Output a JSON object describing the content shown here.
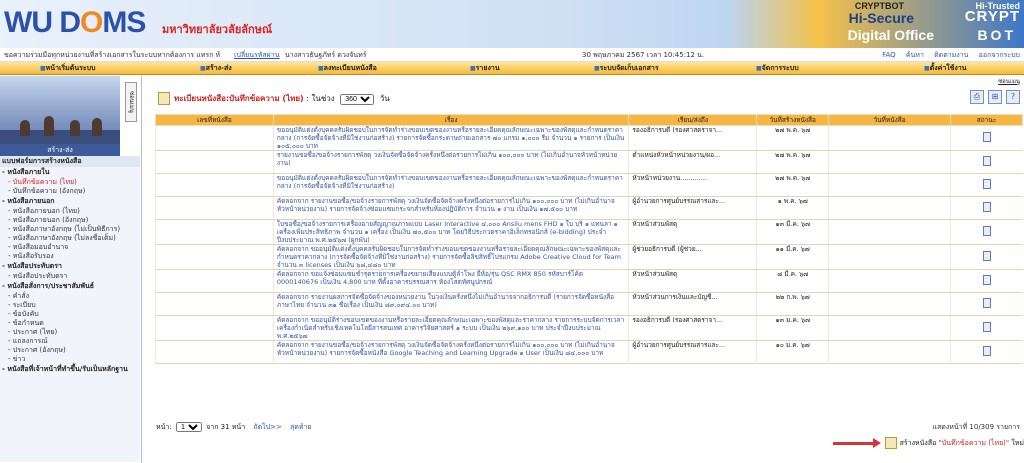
{
  "header": {
    "logo_a": "WU D",
    "logo_b": "O",
    "logo_c": "MS",
    "university": "มหาวิทยาลัยวลัยลักษณ์",
    "brand_line1": "CRYPTBOT",
    "brand_line2": "Hi-Secure",
    "brand_line3": "Digital Office",
    "brand_right1": "Hi-Trusted",
    "brand_right2": "CRYPT",
    "brand_right3": "BOT"
  },
  "infobar": {
    "invite": "ขอความร่วมมือทุกหน่วยงานที่สร้างเอกสารในระบบหากต้องการ แทรก ห้",
    "change_password": "เปลี่ยนรหัสผ่าน",
    "user": "นางสาวธันฐภัทร์ ดวงจันทร์",
    "datetime": "30 พฤษภาคม 2567  เวลา 10:45:12 น.",
    "links": [
      "FAQ",
      "ค้นหา",
      "ติดตามงาน",
      "ออกจากระบบ"
    ]
  },
  "menu": [
    {
      "label": "หน้าเริ่มต้นระบบ"
    },
    {
      "label": "สร้าง-ส่ง"
    },
    {
      "label": "ลงทะเบียนหนังสือ"
    },
    {
      "label": "รายงาน"
    },
    {
      "label": "ระบบจัดเก็บเอกสาร"
    },
    {
      "label": "จัดการระบบ"
    },
    {
      "label": "ตั้งค่าใช้งาน"
    }
  ],
  "sidebar": {
    "caption": "สร้าง-ส่ง",
    "tab": "ซ่อนเมนู",
    "items": [
      {
        "kind": "sh",
        "label": "แบบฟอร์มการสร้างหนังสือ"
      },
      {
        "kind": "sh",
        "label": "- หนังสือภายใน"
      },
      {
        "kind": "si",
        "label": "- บันทึกข้อความ (ไทย)",
        "active": true
      },
      {
        "kind": "si",
        "label": "- บันทึกข้อความ (อังกฤษ)"
      },
      {
        "kind": "sh",
        "label": "- หนังสือภายนอก"
      },
      {
        "kind": "si",
        "label": "- หนังสือภายนอก (ไทย)"
      },
      {
        "kind": "si",
        "label": "- หนังสือภายนอก (อังกฤษ)"
      },
      {
        "kind": "si",
        "label": "- หนังสือภาษาอังกฤษ (ไม่เป็นพิธีการ)"
      },
      {
        "kind": "si",
        "label": "- หนังสือภาษาอังกฤษ (ไม่ลงชื่อเต็ม)"
      },
      {
        "kind": "si",
        "label": "- หนังสือมอบอำนาจ"
      },
      {
        "kind": "si",
        "label": "- หนังสือรับรอง"
      },
      {
        "kind": "sh",
        "label": "- หนังสือประทับตรา"
      },
      {
        "kind": "si",
        "label": "- หนังสือประทับตรา"
      },
      {
        "kind": "sh",
        "label": "- หนังสือสั่งการ/ประชาสัมพันธ์"
      },
      {
        "kind": "si",
        "label": "- คำสั่ง"
      },
      {
        "kind": "si",
        "label": "- ระเบียบ"
      },
      {
        "kind": "si",
        "label": "- ข้อบังคับ"
      },
      {
        "kind": "si",
        "label": "- ข้อกำหนด"
      },
      {
        "kind": "si",
        "label": "- ประกาศ (ไทย)"
      },
      {
        "kind": "si",
        "label": "- แถลงการณ์"
      },
      {
        "kind": "si",
        "label": "- ประกาศ (อังกฤษ)"
      },
      {
        "kind": "si",
        "label": "- ข่าว"
      },
      {
        "kind": "sh",
        "label": "- หนังสือที่เจ้าหน้าที่ทำขึ้น/รับเป็นหลักฐาน"
      }
    ]
  },
  "main": {
    "title": "ทะเบียนหนังสือ:บันทึกข้อความ (ไทย)",
    "in_period_label": ": ในช่วง",
    "period_value": "360",
    "period_unit": "วัน",
    "skip_label": "ซ่อนเมนู",
    "columns": [
      "เลขที่หนังสือ",
      "เรื่อง",
      "เรียน/ส่งถึง",
      "วันที่สร้างหนังสือ",
      "วันที่หนังสือ",
      "สถานะ"
    ],
    "rows": [
      {
        "num": "",
        "subject": "ขออนุมัติแต่งตั้งบุคคลรับผิดชอบในการจัดทำร่างขอบเขตของงานหรือรายละเอียดคุณลักษณะเฉพาะของพัสดุและกำหนดราคากลาง (การจัดซื้อจัดจ้างที่มิใช่งานก่อสร้าง) รายการจัดซื้อกระดาษถ่ายเอกสาร ๗๐ แกรม ๑,๐๐๐ รีม จำนวน ๑ รายการ เป็นเงิน ๑๐๕,๐๐๐ บาท",
        "to": "รองอธิการบดี (รองศาสตราจา...",
        "created": "๒๗ พ.ค. ๖๗",
        "docdate": ""
      },
      {
        "num": "",
        "subject": "รายงานขอซื้อ/ขอจ้างรายการพัสดุ วงเงินจัดซื้อจัดจ้างครั้งหนึ่งต่อรายการไม่เกิน ๑๐๐,๐๐๐ บาท (ไม่เกินอำนาจหัวหน้าหน่วยงาน)",
        "to": "ตำแหน่งหัวหน้าหน่วยงาน/ผอ...",
        "created": "๒๗ พ.ค. ๖๗",
        "docdate": ""
      },
      {
        "num": "",
        "subject": "ขออนุมัติแต่งตั้งบุคคลรับผิดชอบในการจัดทำร่างขอบเขตของงานหรือรายละเอียดคุณลักษณะเฉพาะของพัสดุและกำหนดราคากลาง (การจัดซื้อจัดจ้างที่มิใช่งานก่อสร้าง)",
        "to": "หัวหน้าหน่วยงาน.............",
        "created": "๒๗ พ.ค. ๖๗",
        "docdate": ""
      },
      {
        "num": "",
        "subject": "คัดลอกจาก รายงานขอซื้อ/ขอจ้างรายการพัสดุ วงเงินจัดซื้อจัดจ้างครั้งหนึ่งต่อรายการไม่เกิน ๑๐๐,๐๐๐ บาท (ไม่เกินอำนาจหัวหน้าหน่วยงาน) รายการจัดจ้างซ่อมแซมกระจกสำหรับห้องปฏิบัติการ จำนวน ๑ งาน เป็นเงิน ๑๗,๕๐๐ บาท",
        "to": "ผู้อำนวยการศูนย์บรรณสารและ...",
        "created": "๑ พ.ค. ๖๗",
        "docdate": ""
      },
      {
        "num": "",
        "subject": "ใบขอซื้อ/ขอจ้างรายการเครื่องฉายสัญญาณภาพแบบ Laser Interactive ๔,๐๐๐ Ansilu mens FHD ๑ ใบ บริ ๑ แทนลา ๑ เครื่องเพิ่มประสิทธิภาพ จำนวน ๑ เครื่อง เป็นเงิน ๗๐,๕๐๐ บาท โดยวิธีประกวดราคาอิเล็กทรอนิกส์ (e-bidding) ประจำปีงบประมาณ พ.ศ.๒๕๖๗ (ผูกพัน)",
        "to": "หัวหน้าส่วนพัสดุ",
        "created": "๑๓ มี.ค. ๖๗",
        "docdate": ""
      },
      {
        "num": "",
        "subject": "คัดลอกจาก ขออนุมัติแต่งตั้งบุคคลรับผิดชอบในการจัดทำร่างขอบเขตของงานหรือรายละเอียดคุณลักษณะเฉพาะของพัสดุและกำหนดราคากลาง (การจัดซื้อจัดจ้างที่มิใช่งานก่อสร้าง) รายการจัดซื้อลิขสิทธิ์โปรแกรม Adobe Creative Cloud for Team จำนวน ๓ licenses เป็นเงิน ๖๘,๔๘๐ บาท",
        "to": "ผู้ช่วยอธิการบดี (ผู้ช่วย...",
        "created": "๑๑ มี.ค. ๖๗",
        "docdate": ""
      },
      {
        "num": "",
        "subject": "คัดลอกจาก ขอแจ้งซ่อมแซมชำรุดรายการเครื่องขยายเสียงแบบตู้ลำโพง ยี่ห้อ/รุ่น QSC RMX 850 รหัสบาร์โค้ด 0000140676 เป็นเงิน 4,800 บาท ที่ตั้งอาคารบรรณสาร ห้องโสตทัศนูปกรณ์",
        "to": "หัวหน้าส่วนพัสดุ",
        "created": "๘ มี.ค. ๖๗",
        "docdate": ""
      },
      {
        "num": "",
        "subject": "คัดลอกจาก รายงานผลการจัดซื้อจัดจ้างของหน่วยงาน ในวงเงินครั้งหนึ่งไม่เกินอำนาจจากอธิการบดี (รายการจัดซื้อหนังสือภาษาไทย จำนวน ๓๑ ชื่อเรื่อง เป็นเงิน ๘๙,๐๙๔.๐๐ บาท)",
        "to": "หัวหน้าส่วนการเงินและบัญชี...",
        "created": "๒๒ ก.พ. ๖๗",
        "docdate": ""
      },
      {
        "num": "",
        "subject": "คัดลอกจาก ขออนุมัติร่างขอบเขตของงานหรือรายละเอียดคุณลักษณะเฉพาะของพัสดุและราคากลาง รายการระบบจัดการเวลาเครื่องกำเนิดสำหรับเชิงเทคโนโลยีสารสนเทศ อาคารวิจัยศาสตร์ ๑ ระบบ เป็นเงิน ๒๖๙,๑๐๐ บาท ประจำปีงบประมาณ พ.ศ.๒๕๖๗",
        "to": "รองอธิการบดี (รองศาสตราจา...",
        "created": "๑๓ ม.ค. ๖๗",
        "docdate": ""
      },
      {
        "num": "",
        "subject": "คัดลอกจาก รายงานขอซื้อ/ขอจ้างรายการพัสดุ วงเงินจัดซื้อจัดจ้างครั้งหนึ่งต่อรายการไม่เกิน ๑๐๐,๐๐๐ บาท (ไม่เกินอำนาจหัวหน้าหน่วยงาน) รายการจัดซื้อหนังสือ Google Teaching and Learning Upgrade ๑ User เป็นเงิน ๘๔,๐๐๐ บาท",
        "to": "ผู้อำนวยการศูนย์บรรณสารและ...",
        "created": "๑๐ ม.ค. ๖๗",
        "docdate": ""
      }
    ],
    "page_label": "หน้า:",
    "page_value": "1",
    "page_of": "จาก 31 หน้า",
    "next_label": "ถัดไป>>",
    "last_label": "สุดท้าย",
    "count": "แสดงหน้าที่ 10/309 รายการ",
    "create_label": "สร้างหนังสือ ",
    "create_type": "\"บันทึกข้อความ (ไทย)\"",
    "create_tail": " ใหม่"
  }
}
